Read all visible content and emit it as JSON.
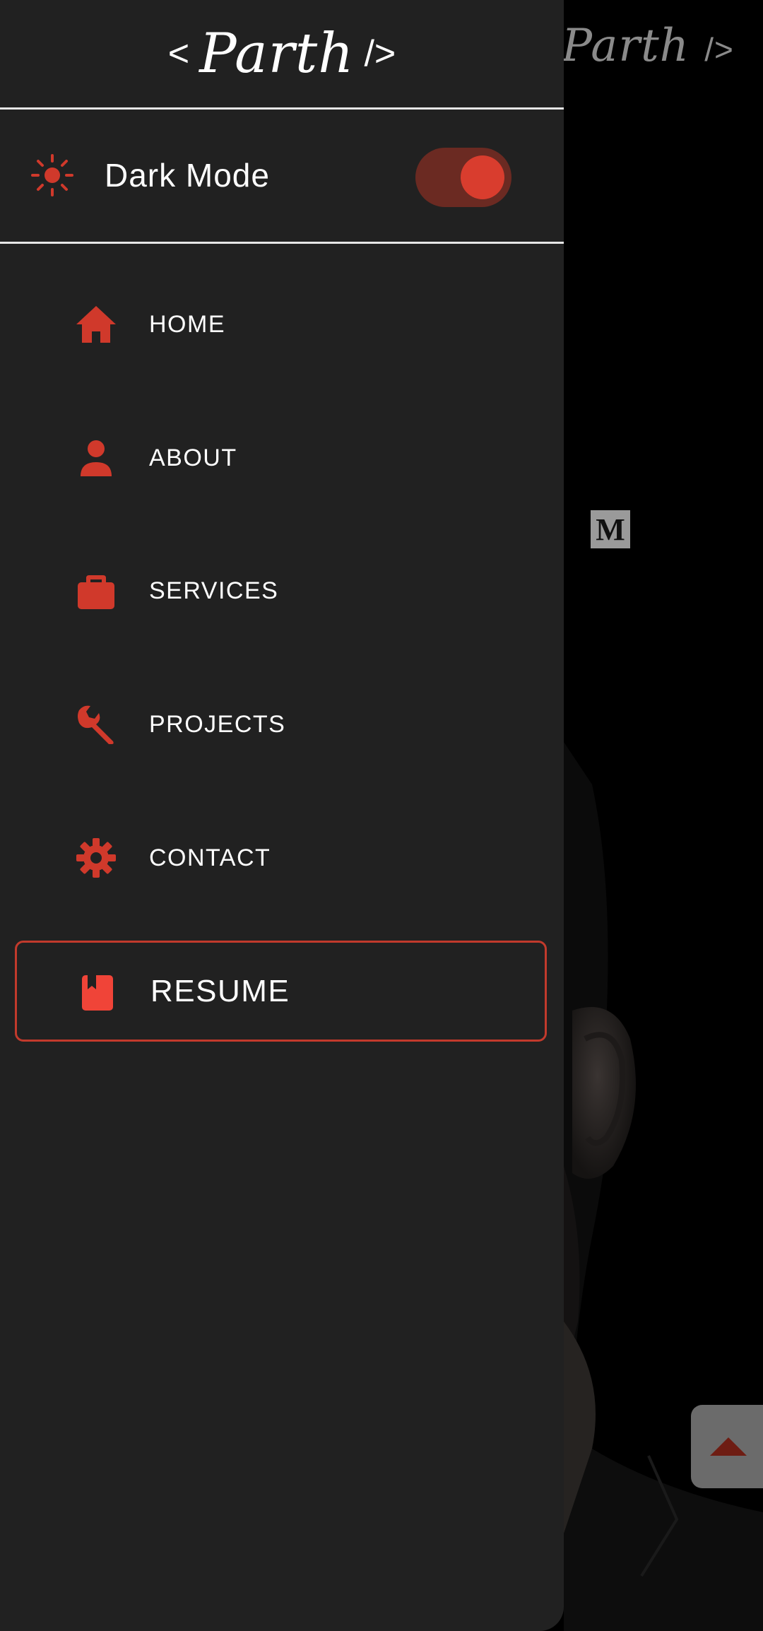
{
  "colors": {
    "accent": "#d0392b",
    "drawer_bg": "#212121",
    "page_bg": "#000000",
    "text": "#ffffff",
    "divider": "#e6e6e6"
  },
  "brand": {
    "open": "<",
    "signature": "Parth",
    "close": "/>"
  },
  "background": {
    "logo_signature": "Parth",
    "logo_close": "/>",
    "medium_letter": "M",
    "scroll_top_icon": "caret-up-icon"
  },
  "dark_mode": {
    "label": "Dark Mode",
    "icon": "sun-icon",
    "enabled": true
  },
  "menu": {
    "items": [
      {
        "label": "HOME",
        "icon": "home-icon"
      },
      {
        "label": "ABOUT",
        "icon": "person-icon"
      },
      {
        "label": "SERVICES",
        "icon": "briefcase-icon"
      },
      {
        "label": "PROJECTS",
        "icon": "wrench-icon"
      },
      {
        "label": "CONTACT",
        "icon": "gear-icon"
      }
    ],
    "resume": {
      "label": "RESUME",
      "icon": "book-icon"
    }
  }
}
